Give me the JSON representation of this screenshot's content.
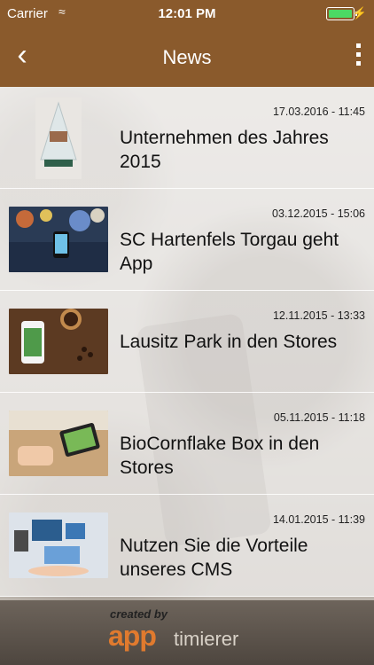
{
  "status_bar": {
    "carrier": "Carrier",
    "wifi_icon": "wifi-icon",
    "time": "12:01 PM",
    "battery_icon": "battery-icon",
    "battery_level": 1.0,
    "charging_icon": "bolt-icon"
  },
  "nav": {
    "title": "News",
    "back_icon": "chevron-left-icon",
    "more_icon": "more-vertical-icon"
  },
  "news": [
    {
      "date": "17.03.2016 - 11:45",
      "title": "Unternehmen des Jahres 2015"
    },
    {
      "date": "03.12.2015 - 15:06",
      "title": "SC Hartenfels Torgau geht App"
    },
    {
      "date": "12.11.2015 - 13:33",
      "title": "Lausitz Park in den Stores"
    },
    {
      "date": "05.11.2015 - 11:18",
      "title": "BioCornflake Box in den Stores"
    },
    {
      "date": "14.01.2015 - 11:39",
      "title": "Nutzen Sie die Vorteile unseres CMS"
    }
  ],
  "footer": {
    "created_by": "created by",
    "brand_left": "app",
    "brand_right": "timierer"
  },
  "colors": {
    "nav_background": "#8a5a2c",
    "brand_orange": "#e07a2e",
    "battery_green": "#4cd964"
  }
}
